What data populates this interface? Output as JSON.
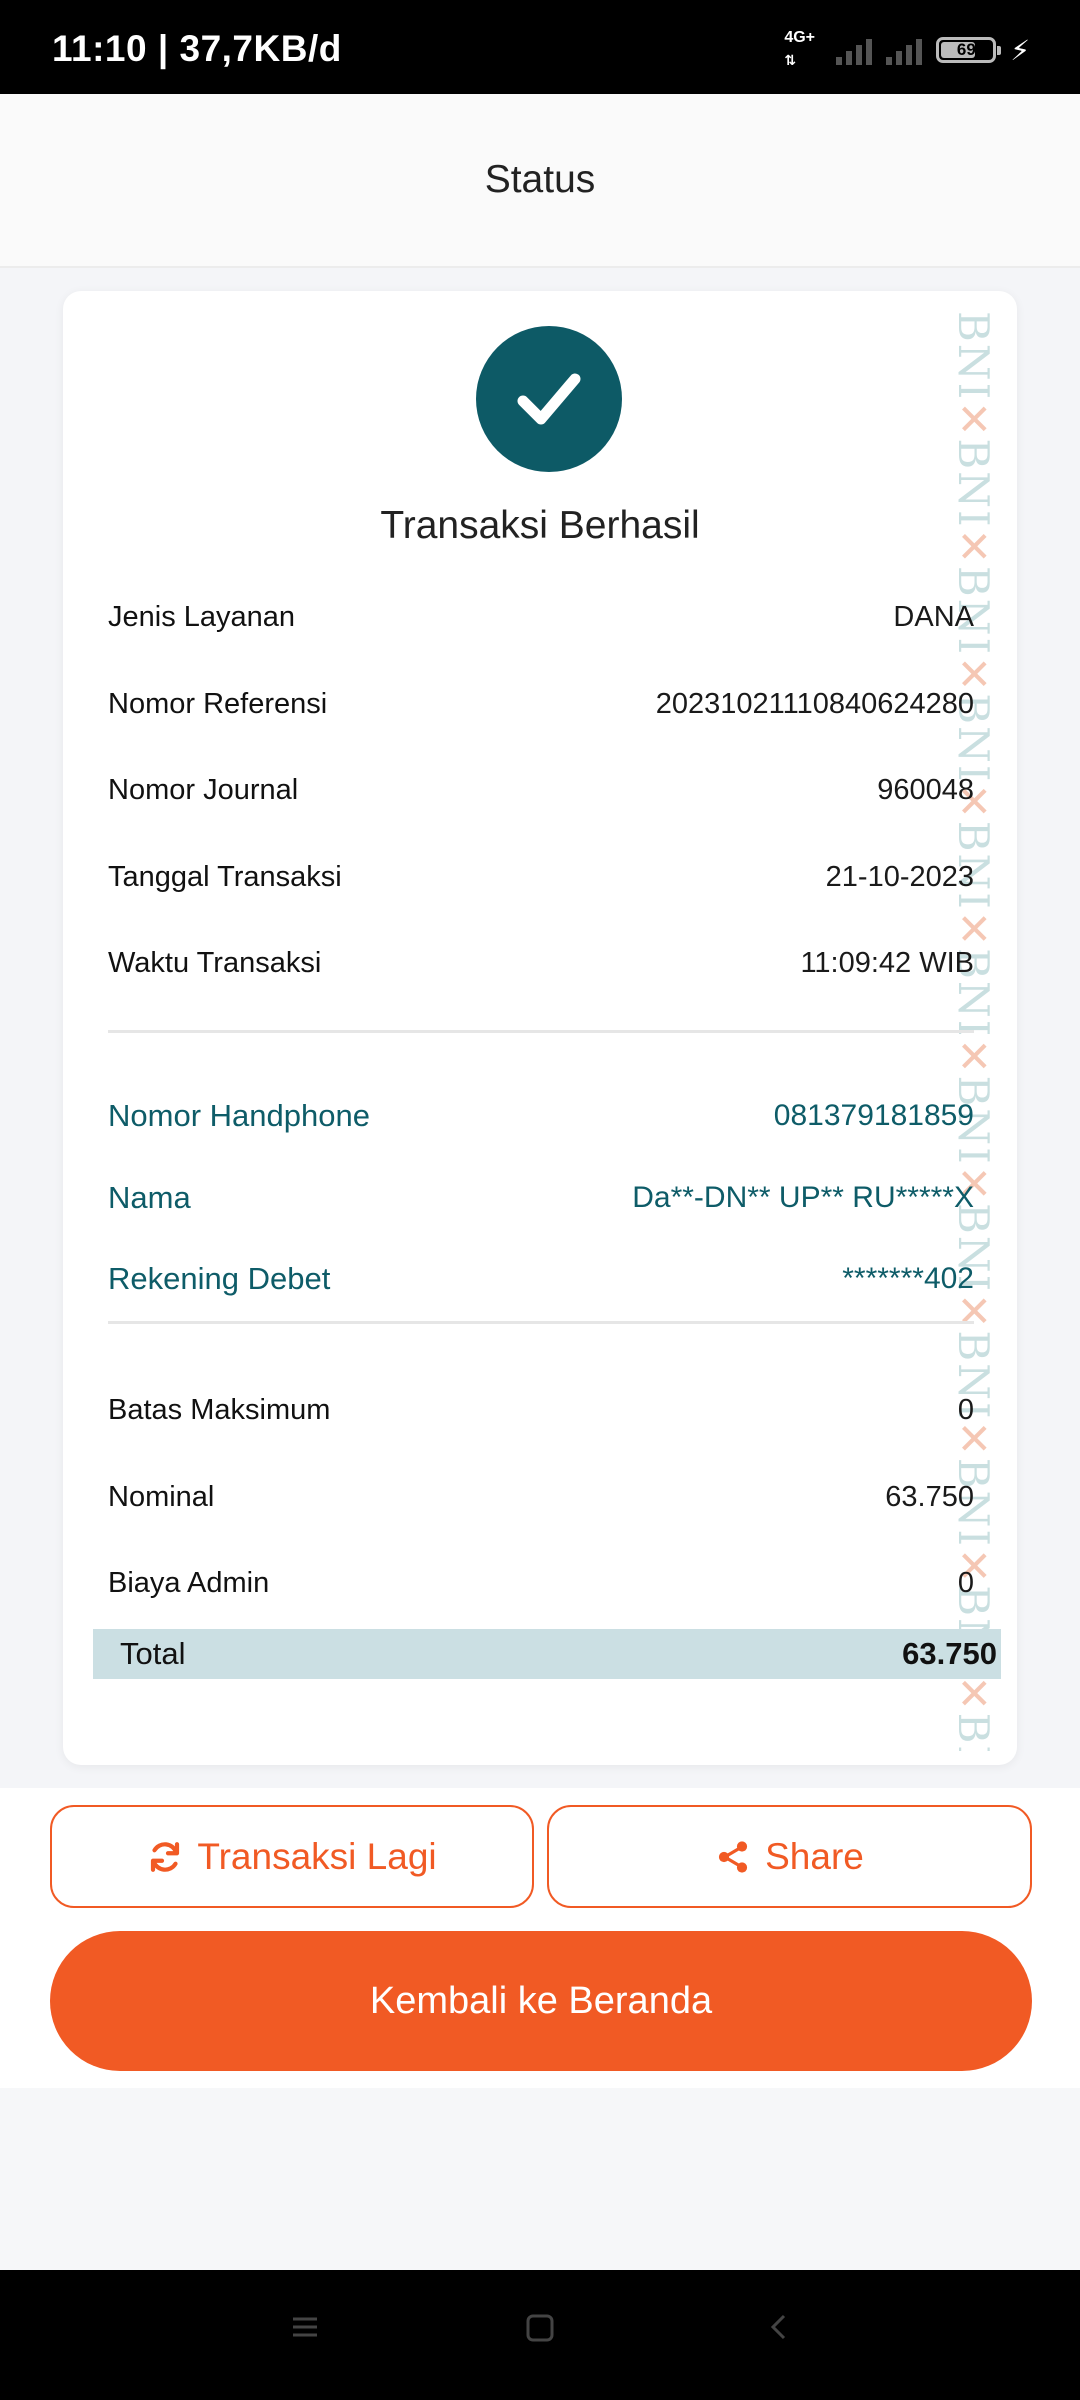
{
  "status_bar": {
    "time_speed": "11:10 | 37,7KB/d",
    "network": "4G+",
    "battery": "69"
  },
  "header": {
    "title": "Status"
  },
  "receipt": {
    "status_title": "Transaksi Berhasil",
    "watermark": "BNI",
    "details": [
      {
        "label": "Jenis Layanan",
        "value": "DANA"
      },
      {
        "label": "Nomor Referensi",
        "value": "20231021110840624280"
      },
      {
        "label": "Nomor Journal",
        "value": "960048"
      },
      {
        "label": "Tanggal Transaksi",
        "value": "21-10-2023"
      },
      {
        "label": "Waktu Transaksi",
        "value": "11:09:42 WIB"
      }
    ],
    "customer": [
      {
        "label": "Nomor Handphone",
        "value": "081379181859"
      },
      {
        "label": "Nama",
        "value": "Da**-DN** UP** RU*****X"
      },
      {
        "label": "Rekening Debet",
        "value": "*******402"
      }
    ],
    "amounts": [
      {
        "label": "Batas Maksimum",
        "value": "0"
      },
      {
        "label": "Nominal",
        "value": "63.750"
      },
      {
        "label": "Biaya Admin",
        "value": "0"
      }
    ],
    "total": {
      "label": "Total",
      "value": "63.750"
    }
  },
  "actions": {
    "repeat_label": "Transaksi Lagi",
    "share_label": "Share",
    "home_label": "Kembali ke Beranda"
  },
  "colors": {
    "accent": "#f15a24",
    "teal": "#0e5c68",
    "total_bg": "#cbdfe3"
  },
  "icons": {
    "success": "check-circle-icon",
    "repeat": "refresh-icon",
    "share": "share-icon"
  }
}
